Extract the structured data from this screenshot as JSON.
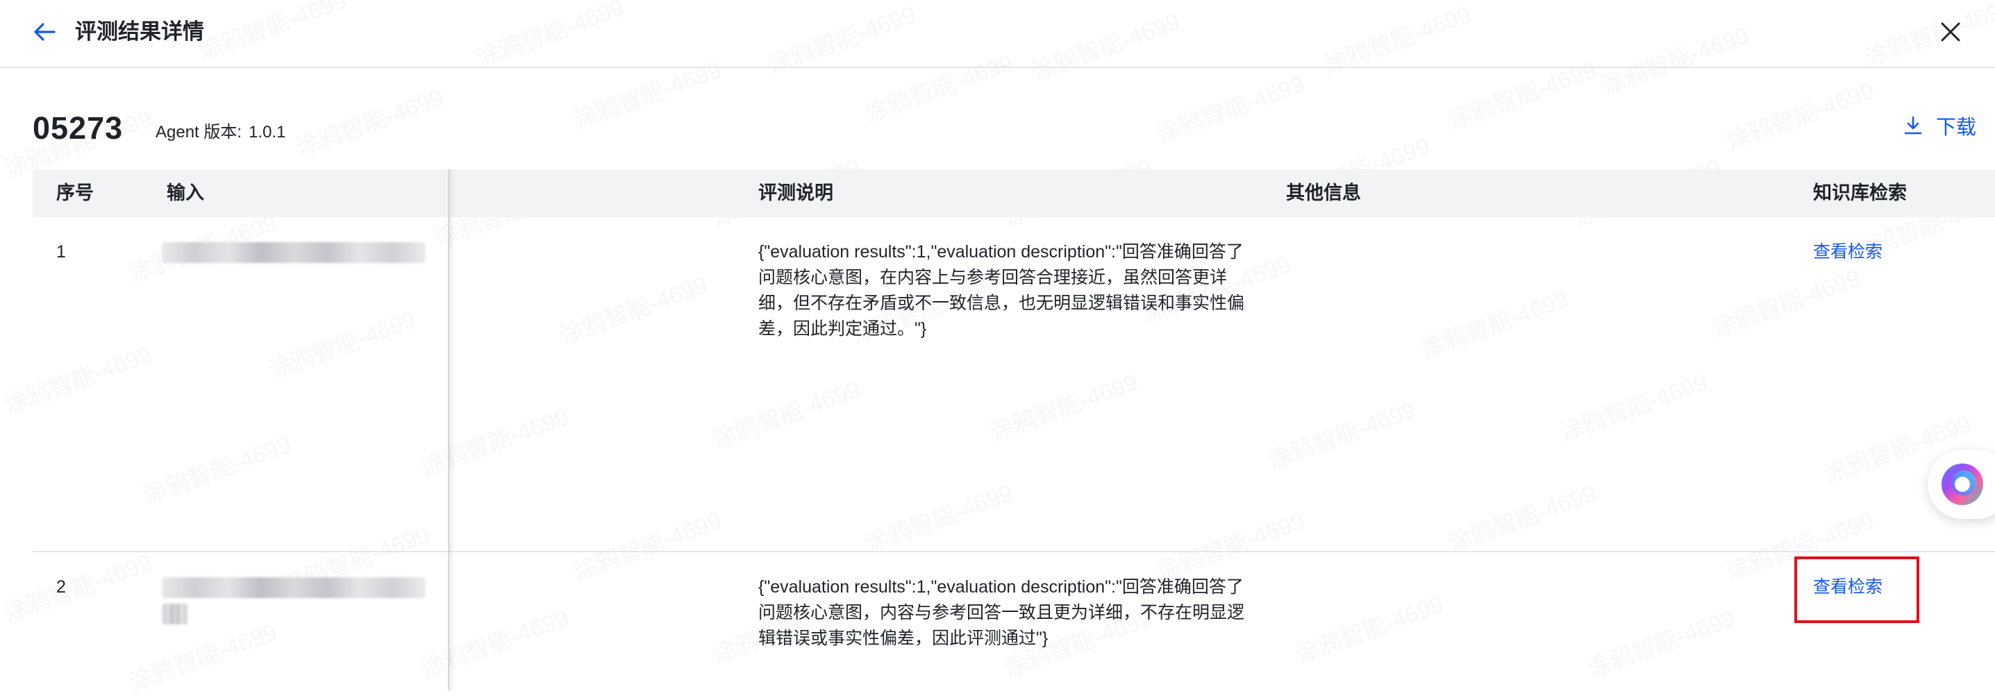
{
  "header": {
    "title": "评测结果详情",
    "back_icon": "arrow-left-icon",
    "close_icon": "close-icon"
  },
  "record": {
    "id": "05273",
    "version_label": "Agent 版本:",
    "version_value": "1.0.1"
  },
  "download": {
    "label": "下载",
    "icon": "download-icon"
  },
  "table": {
    "columns": {
      "seq": "序号",
      "input": "输入",
      "description": "评测说明",
      "other": "其他信息",
      "kb_search": "知识库检索"
    },
    "rows": [
      {
        "seq": "1",
        "description": "{\"evaluation results\":1,\"evaluation description\":\"回答准确回答了问题核心意图，在内容上与参考回答合理接近，虽然回答更详细，但不存在矛盾或不一致信息，也无明显逻辑错误和事实性偏差，因此判定通过。\"}",
        "link": "查看检索"
      },
      {
        "seq": "2",
        "description": "{\"evaluation results\":1,\"evaluation description\":\"回答准确回答了问题核心意图，内容与参考回答一致且更为详细，不存在明显逻辑错误或事实性偏差，因此评测通过\"}",
        "link": "查看检索"
      }
    ]
  },
  "colors": {
    "accent": "#1456f0",
    "highlight": "#e0101a",
    "header_bg": "#f2f3f5"
  },
  "watermark_text": "涂鸦智能-4699"
}
